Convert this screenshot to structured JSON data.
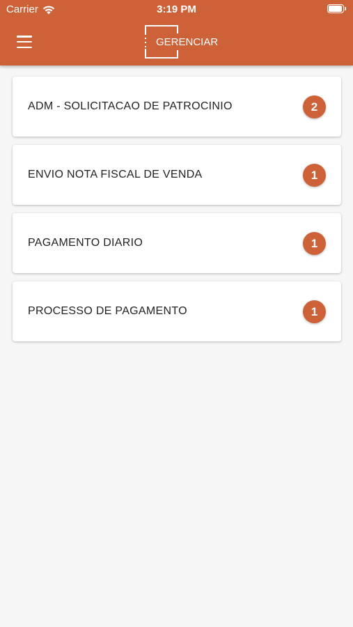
{
  "status_bar": {
    "carrier": "Carrier",
    "time": "3:19 PM"
  },
  "header": {
    "logo_text": "GERENCIAR",
    "menu_icon": "hamburger-menu-icon",
    "color": "#cd6239"
  },
  "items": [
    {
      "title": "ADM - SOLICITACAO DE PATROCINIO",
      "count": "2"
    },
    {
      "title": "ENVIO NOTA FISCAL DE VENDA",
      "count": "1"
    },
    {
      "title": "PAGAMENTO DIARIO",
      "count": "1"
    },
    {
      "title": "PROCESSO DE PAGAMENTO",
      "count": "1"
    }
  ]
}
